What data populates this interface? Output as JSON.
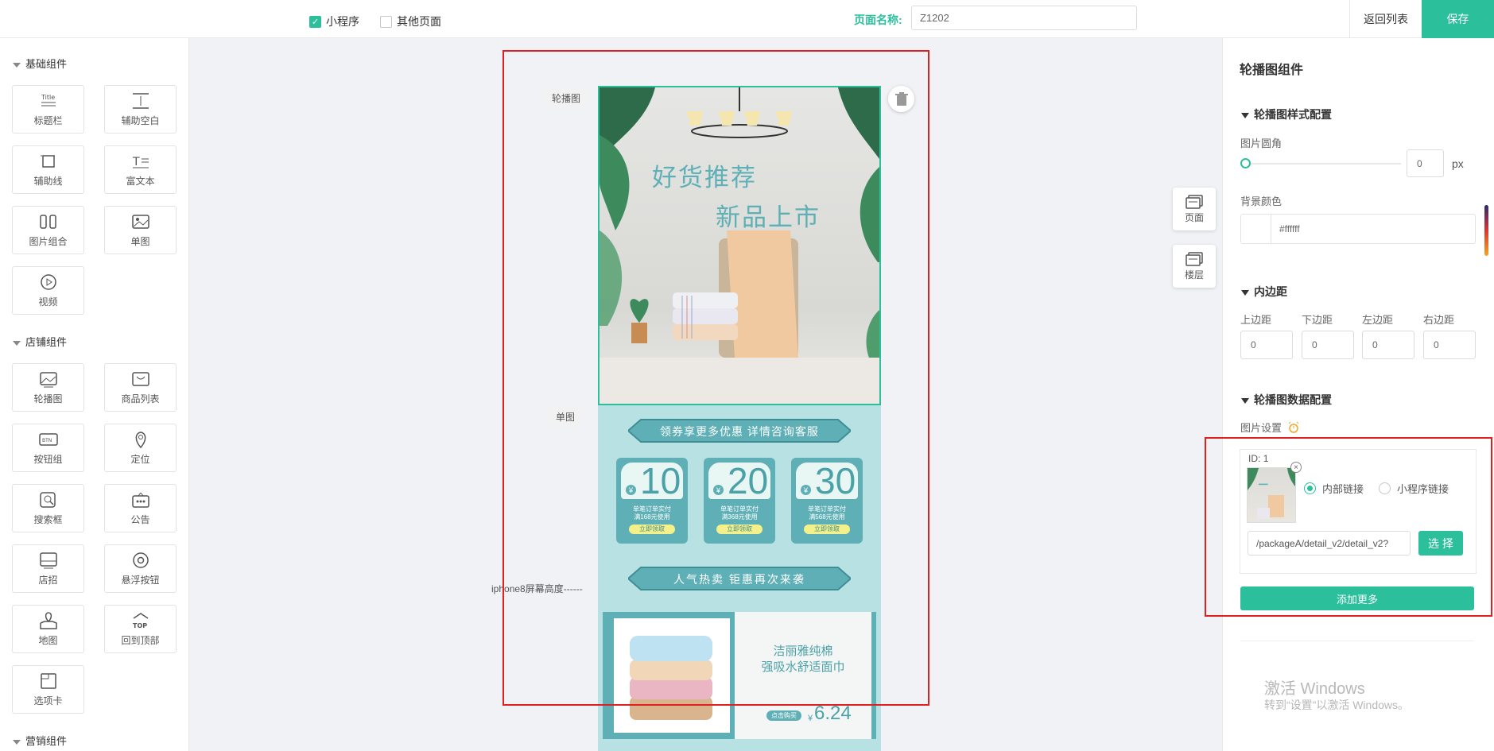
{
  "topbar": {
    "mini_program_label": "小程序",
    "mini_program_checked": true,
    "other_pages_label": "其他页面",
    "other_pages_checked": false,
    "page_name_label": "页面名称:",
    "page_name_value": "Z1202",
    "back_label": "返回列表",
    "save_label": "保存"
  },
  "left": {
    "basic_group": "基础组件",
    "basic_items": [
      {
        "label": "标题栏",
        "icon": "title-icon"
      },
      {
        "label": "辅助空白",
        "icon": "spacer-icon"
      },
      {
        "label": "辅助线",
        "icon": "divider-icon"
      },
      {
        "label": "富文本",
        "icon": "richtext-icon"
      },
      {
        "label": "图片组合",
        "icon": "image-group-icon"
      },
      {
        "label": "单图",
        "icon": "image-icon"
      },
      {
        "label": "视频",
        "icon": "video-icon"
      }
    ],
    "shop_group": "店铺组件",
    "shop_items": [
      {
        "label": "轮播图",
        "icon": "carousel-icon"
      },
      {
        "label": "商品列表",
        "icon": "product-list-icon"
      },
      {
        "label": "按钮组",
        "icon": "button-group-icon"
      },
      {
        "label": "定位",
        "icon": "location-icon"
      },
      {
        "label": "搜索框",
        "icon": "search-icon"
      },
      {
        "label": "公告",
        "icon": "notice-icon"
      },
      {
        "label": "店招",
        "icon": "shop-sign-icon"
      },
      {
        "label": "悬浮按钮",
        "icon": "float-button-icon"
      },
      {
        "label": "地图",
        "icon": "map-icon"
      },
      {
        "label": "回到顶部",
        "icon": "back-to-top-icon"
      },
      {
        "label": "选项卡",
        "icon": "tab-icon"
      }
    ],
    "marketing_group": "营销组件"
  },
  "canvas": {
    "carousel_tag": "轮播图",
    "single_image_tag": "单图",
    "screen_marker": "iphone8屏幕高度",
    "banner_line1": "好货推荐",
    "banner_line2": "新品上市",
    "ribbon1": "领券享更多优惠 详情咨询客服",
    "coupons": [
      {
        "amount": "10",
        "line1": "单笔订单实付",
        "line2": "满168元使用",
        "btn": "立即领取"
      },
      {
        "amount": "20",
        "line1": "单笔订单实付",
        "line2": "满368元使用",
        "btn": "立即领取"
      },
      {
        "amount": "30",
        "line1": "单笔订单实付",
        "line2": "满568元使用",
        "btn": "立即领取"
      }
    ],
    "currency": "¥",
    "ribbon2": "人气热卖 钜惠再次来袭",
    "product_line1": "洁丽雅纯棉",
    "product_line2": "强吸水舒适面巾",
    "product_buy": "点击购买",
    "product_price": "6.24",
    "page_tool": "页面",
    "floor_tool": "楼层"
  },
  "right": {
    "title": "轮播图组件",
    "style_section": "轮播图样式配置",
    "radius_label": "图片圆角",
    "radius_value": "0",
    "radius_unit": "px",
    "radius_slider_fraction": 0,
    "bg_label": "背景颜色",
    "bg_value": "#ffffff",
    "padding_section": "内边距",
    "padding_labels": [
      "上边距",
      "下边距",
      "左边距",
      "右边距"
    ],
    "padding_values": [
      "0",
      "0",
      "0",
      "0"
    ],
    "data_section": "轮播图数据配置",
    "image_settings_label": "图片设置",
    "item_id_label": "ID:",
    "item_id": "1",
    "internal_link": "内部链接",
    "mini_link": "小程序链接",
    "link_value": "/packageA/detail_v2/detail_v2?",
    "select_btn": "选 择",
    "add_more": "添加更多"
  },
  "watermark": {
    "line1": "激活 Windows",
    "line2": "转到“设置”以激活 Windows。"
  },
  "colors": {
    "accent": "#2bbf9c",
    "highlight": "#e02020",
    "teal_dark": "#5fb0b6"
  }
}
